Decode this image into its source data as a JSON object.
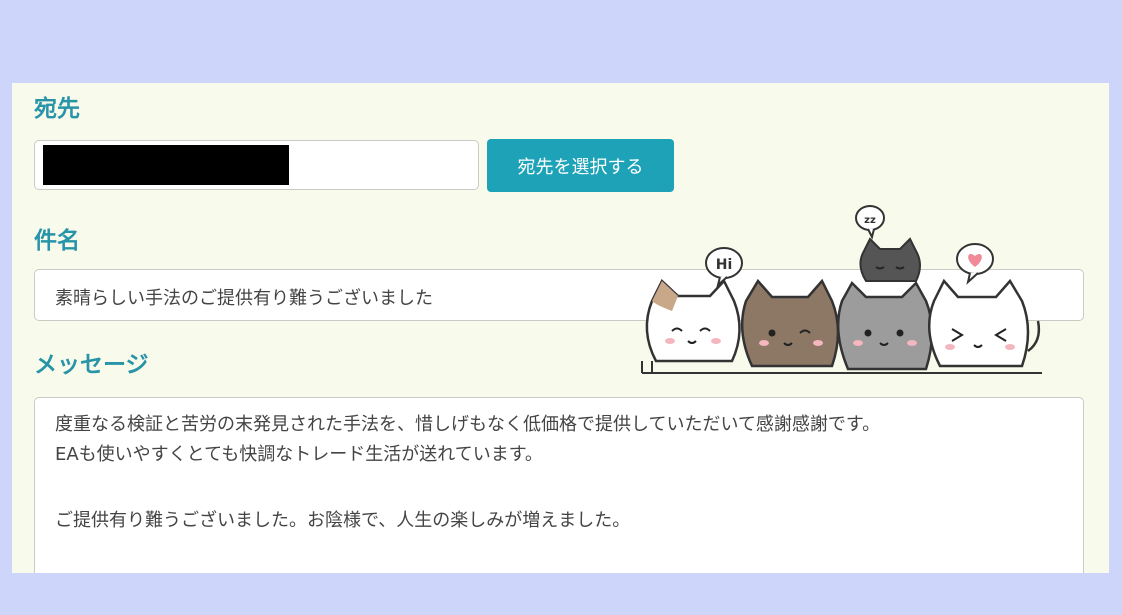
{
  "recipient": {
    "label": "宛先",
    "select_button": "宛先を選択する"
  },
  "subject": {
    "label": "件名",
    "value": "素晴らしい手法のご提供有り難うございました"
  },
  "message": {
    "label": "メッセージ",
    "lines": [
      "度重なる検証と苦労の末発見された手法を、惜しげもなく低価格で提供していただいて感謝感謝です。",
      "EAも使いやすくとても快調なトレード生活が送れています。",
      "",
      "ご提供有り難うございました。お陰様で、人生の楽しみが増えました。"
    ]
  },
  "illustration": {
    "bubble_hi": "Hi",
    "bubble_sleep": "zz"
  },
  "colors": {
    "accent": "#2794a8",
    "button": "#1ea2b7",
    "panel": "#f8faec",
    "background": "#cdd5fb"
  }
}
